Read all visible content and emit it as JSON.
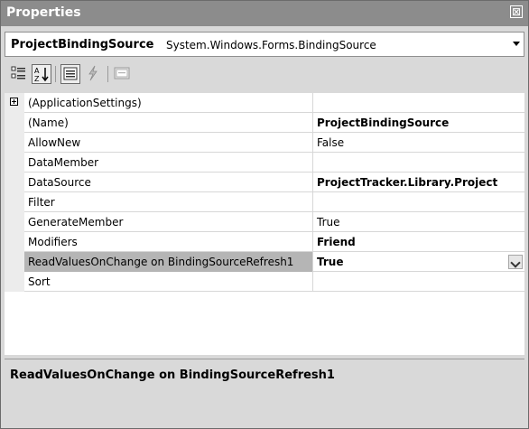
{
  "window": {
    "title": "Properties",
    "close_glyph": "⊠"
  },
  "object_selector": {
    "name": "ProjectBindingSource",
    "type": "System.Windows.Forms.BindingSource"
  },
  "toolbar": {
    "buttons": [
      {
        "name": "categorized",
        "icon": "categorized-icon",
        "pressed": false
      },
      {
        "name": "alphabetical",
        "icon": "alphabetical-icon",
        "pressed": true
      },
      {
        "name": "properties",
        "icon": "properties-icon",
        "pressed": true
      },
      {
        "name": "events",
        "icon": "lightning-icon",
        "pressed": false
      },
      {
        "name": "property-pages",
        "icon": "property-pages-icon",
        "pressed": false
      }
    ]
  },
  "properties": [
    {
      "name": "(ApplicationSettings)",
      "value": "",
      "expandable": true
    },
    {
      "name": "(Name)",
      "value": "ProjectBindingSource",
      "bold": true
    },
    {
      "name": "AllowNew",
      "value": "False"
    },
    {
      "name": "DataMember",
      "value": ""
    },
    {
      "name": "DataSource",
      "value": "ProjectTracker.Library.Project",
      "bold": true
    },
    {
      "name": "Filter",
      "value": ""
    },
    {
      "name": "GenerateMember",
      "value": "True"
    },
    {
      "name": "Modifiers",
      "value": "Friend",
      "bold": true
    },
    {
      "name": "ReadValuesOnChange on BindingSourceRefresh1",
      "value": "True",
      "bold": true,
      "selected": true
    },
    {
      "name": "Sort",
      "value": ""
    }
  ],
  "description": {
    "title": "ReadValuesOnChange on BindingSourceRefresh1"
  }
}
